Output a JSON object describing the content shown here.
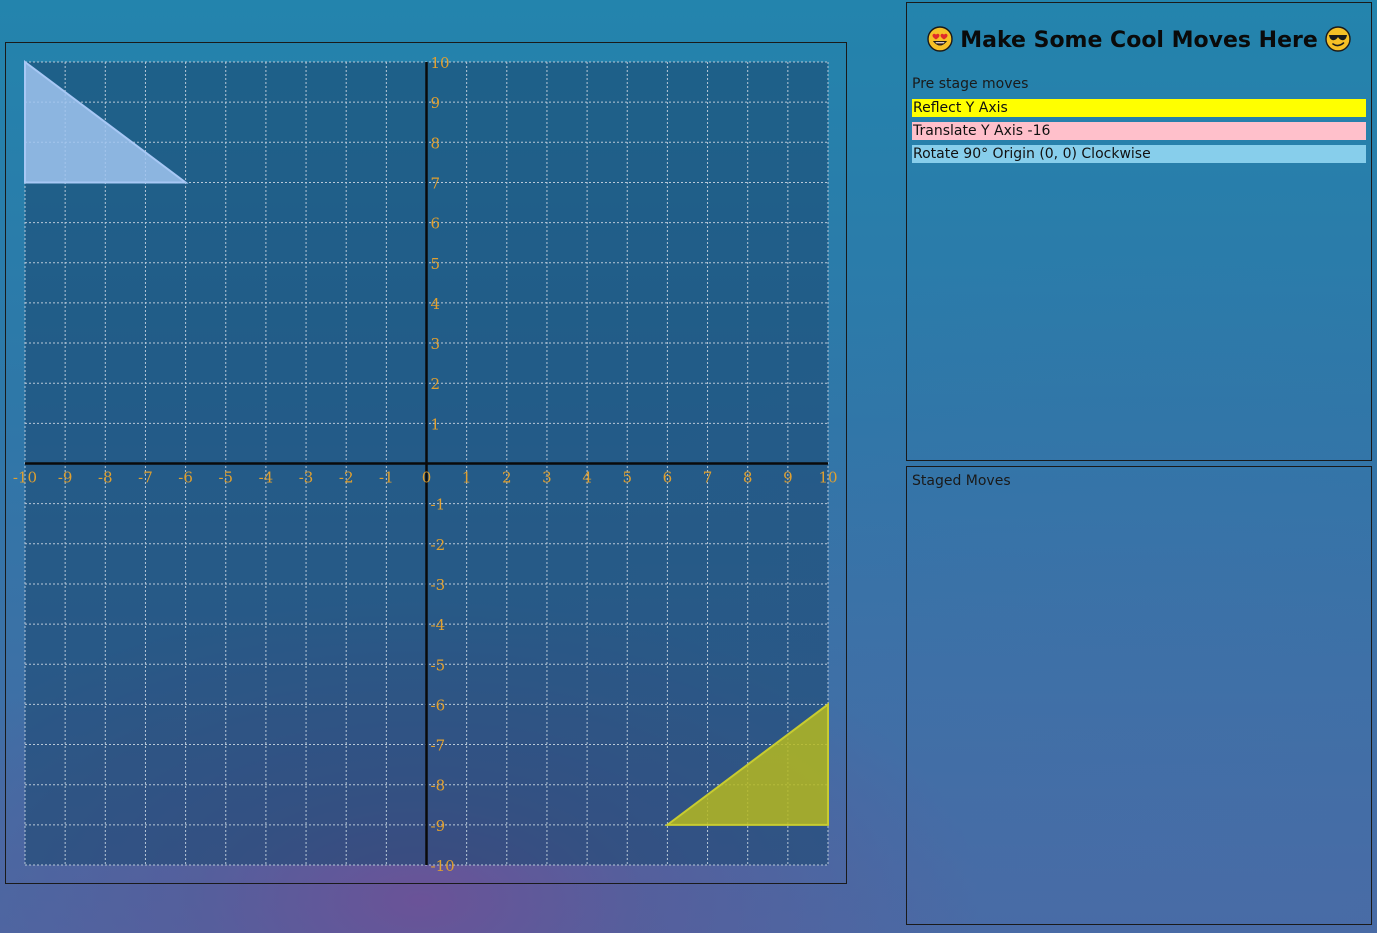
{
  "header": {
    "title": "Make Some Cool Moves Here",
    "left_icon": "heart-eyes-face-icon",
    "right_icon": "sunglasses-face-icon"
  },
  "pre_stage": {
    "label": "Pre stage moves",
    "moves": [
      {
        "label": "Reflect Y Axis",
        "color": "#ffff00"
      },
      {
        "label": "Translate Y Axis -16",
        "color": "#ffc0cb"
      },
      {
        "label": "Rotate 90° Origin (0, 0) Clockwise",
        "color": "#87ceeb"
      }
    ]
  },
  "staged": {
    "label": "Staged Moves",
    "moves": []
  },
  "graph": {
    "x_range": [
      -10,
      10
    ],
    "y_range": [
      -10,
      10
    ],
    "x_ticks": [
      "-10",
      "-9",
      "-8",
      "-7",
      "-6",
      "-5",
      "-4",
      "-3",
      "-2",
      "-1",
      "0",
      "1",
      "2",
      "3",
      "4",
      "5",
      "6",
      "7",
      "8",
      "9",
      "10"
    ],
    "y_ticks": [
      "10",
      "9",
      "8",
      "7",
      "6",
      "5",
      "4",
      "3",
      "2",
      "1",
      "-1",
      "-2",
      "-3",
      "-4",
      "-5",
      "-6",
      "-7",
      "-8",
      "-9",
      "-10"
    ],
    "axis_label_color": "#e0a030",
    "shapes": [
      {
        "name": "source-triangle",
        "points": [
          [
            -10,
            10
          ],
          [
            -10,
            7
          ],
          [
            -6,
            7
          ]
        ],
        "fill": "#a0c4f0",
        "stroke": "#a8c8f5"
      },
      {
        "name": "target-triangle",
        "points": [
          [
            6,
            -9
          ],
          [
            10,
            -9
          ],
          [
            10,
            -6
          ]
        ],
        "fill": "#b5b820",
        "stroke": "#c8cc30"
      }
    ]
  }
}
